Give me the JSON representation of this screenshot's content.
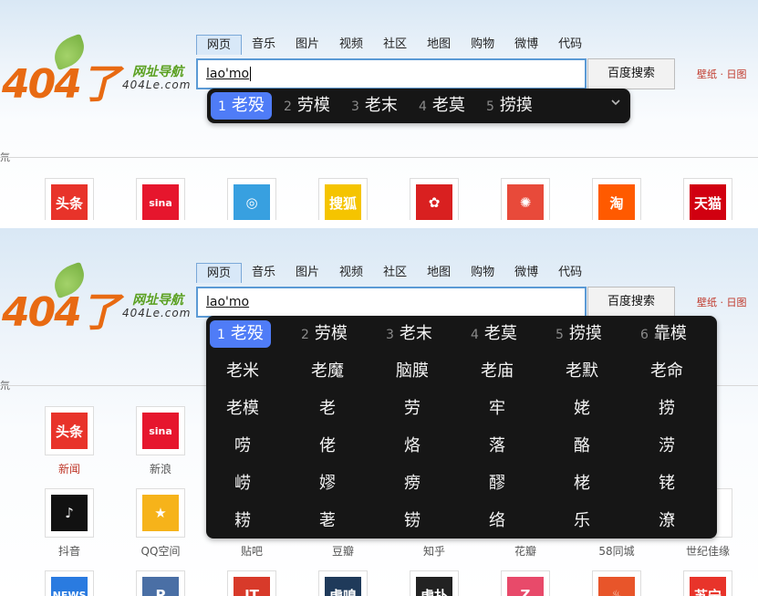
{
  "logo": {
    "number": "404了",
    "cn_name": "网址导航",
    "url": "404Le.com"
  },
  "tabs": [
    "网页",
    "音乐",
    "图片",
    "视频",
    "社区",
    "地图",
    "购物",
    "微博",
    "代码"
  ],
  "search": {
    "input_value": "lao'mo",
    "button_label": "百度搜索",
    "wallpaper_label": "壁纸 · 日图"
  },
  "section_mark": "氘",
  "ime_collapsed": {
    "candidates": [
      {
        "num": "1",
        "text": "老殁"
      },
      {
        "num": "2",
        "text": "劳模"
      },
      {
        "num": "3",
        "text": "老末"
      },
      {
        "num": "4",
        "text": "老莫"
      },
      {
        "num": "5",
        "text": "捞摸"
      }
    ]
  },
  "ime_expanded": {
    "candidates": [
      {
        "num": "1",
        "text": "老殁"
      },
      {
        "num": "2",
        "text": "劳模"
      },
      {
        "num": "3",
        "text": "老末"
      },
      {
        "num": "4",
        "text": "老莫"
      },
      {
        "num": "5",
        "text": "捞摸"
      },
      {
        "num": "6",
        "text": "靠模"
      }
    ],
    "grid": [
      [
        "老米",
        "老魔",
        "脑膜",
        "老庙",
        "老默",
        "老命"
      ],
      [
        "老模",
        "老",
        "劳",
        "牢",
        "姥",
        "捞"
      ],
      [
        "唠",
        "佬",
        "烙",
        "落",
        "酪",
        "涝"
      ],
      [
        "崂",
        "嫪",
        "痨",
        "醪",
        "栳",
        "铑"
      ],
      [
        "耢",
        "荖",
        "铹",
        "络",
        "乐",
        "潦"
      ]
    ]
  },
  "sites_row1": [
    {
      "name": "头条",
      "label": "新闻",
      "icon_text": "头条",
      "color": "#e8332a",
      "red": true
    },
    {
      "name": "sina",
      "label": "新浪",
      "icon_text": "sina",
      "color": "#e6162d",
      "red": false
    }
  ],
  "sites_row1_top_icons": [
    {
      "icon_text": "头条",
      "color": "#e8332a"
    },
    {
      "icon_text": "sina",
      "color": "#e6162d"
    },
    {
      "icon_text": "◎",
      "color": "#38a0e0"
    },
    {
      "icon_text": "搜狐",
      "color": "#f5c400"
    },
    {
      "icon_text": "✿",
      "color": "#d92020"
    },
    {
      "icon_text": "✺",
      "color": "#e84a3a"
    },
    {
      "icon_text": "淘",
      "color": "#ff5a00"
    },
    {
      "icon_text": "天猫",
      "color": "#d10010"
    }
  ],
  "sites_row2": [
    {
      "label": "抖音",
      "icon_text": "♪",
      "color": "#111111"
    },
    {
      "label": "QQ空间",
      "icon_text": "★",
      "color": "#f6b31a"
    },
    {
      "label": "贴吧"
    },
    {
      "label": "豆瓣"
    },
    {
      "label": "知乎"
    },
    {
      "label": "花瓣"
    },
    {
      "label": "58同城"
    },
    {
      "label": "世纪佳缘"
    }
  ],
  "sites_row3_icons": [
    {
      "icon_text": "NEWS",
      "color": "#2a7be0"
    },
    {
      "icon_text": "P",
      "color": "#4a6fa5"
    },
    {
      "icon_text": "IT",
      "color": "#d83a2a"
    },
    {
      "icon_text": "虎嗅",
      "color": "#1f3a5a"
    },
    {
      "icon_text": "虎扑",
      "color": "#222222"
    },
    {
      "icon_text": "Z",
      "color": "#e84a6a"
    },
    {
      "icon_text": "♨",
      "color": "#e8552a"
    },
    {
      "icon_text": "苏宁",
      "color": "#e8342a"
    }
  ]
}
